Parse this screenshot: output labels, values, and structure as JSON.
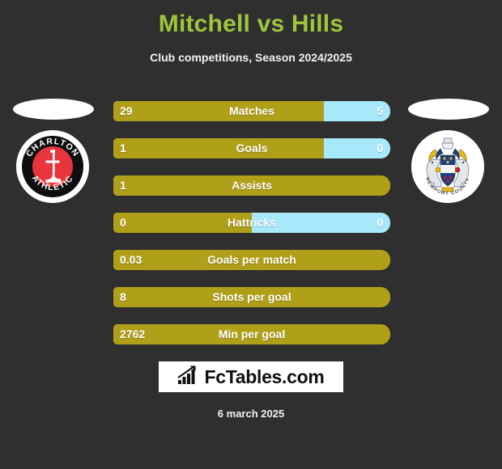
{
  "header": {
    "title": "Mitchell vs Hills",
    "subtitle": "Club competitions, Season 2024/2025",
    "title_color": "#9dc63b"
  },
  "theme": {
    "background": "#2f2f2f",
    "bar_left_color": "#b0a019",
    "bar_right_color": "#a8e8fb",
    "text_color": "#ffffff"
  },
  "teams": {
    "home": {
      "name": "Charlton Athletic",
      "crest": "charlton-athletic-crest"
    },
    "away": {
      "name": "Newport County",
      "crest": "newport-county-crest"
    }
  },
  "stats": [
    {
      "label": "Matches",
      "left": "29",
      "right": "5",
      "left_pct": 76
    },
    {
      "label": "Goals",
      "left": "1",
      "right": "0",
      "left_pct": 76
    },
    {
      "label": "Assists",
      "left": "1",
      "right": "",
      "left_pct": 100
    },
    {
      "label": "Hattricks",
      "left": "0",
      "right": "0",
      "left_pct": 50
    },
    {
      "label": "Goals per match",
      "left": "0.03",
      "right": "",
      "left_pct": 100
    },
    {
      "label": "Shots per goal",
      "left": "8",
      "right": "",
      "left_pct": 100
    },
    {
      "label": "Min per goal",
      "left": "2762",
      "right": "",
      "left_pct": 100
    }
  ],
  "footer": {
    "brand": "FcTables.com",
    "brand_icon": "bar-chart-growth-icon",
    "date": "6 march 2025"
  }
}
